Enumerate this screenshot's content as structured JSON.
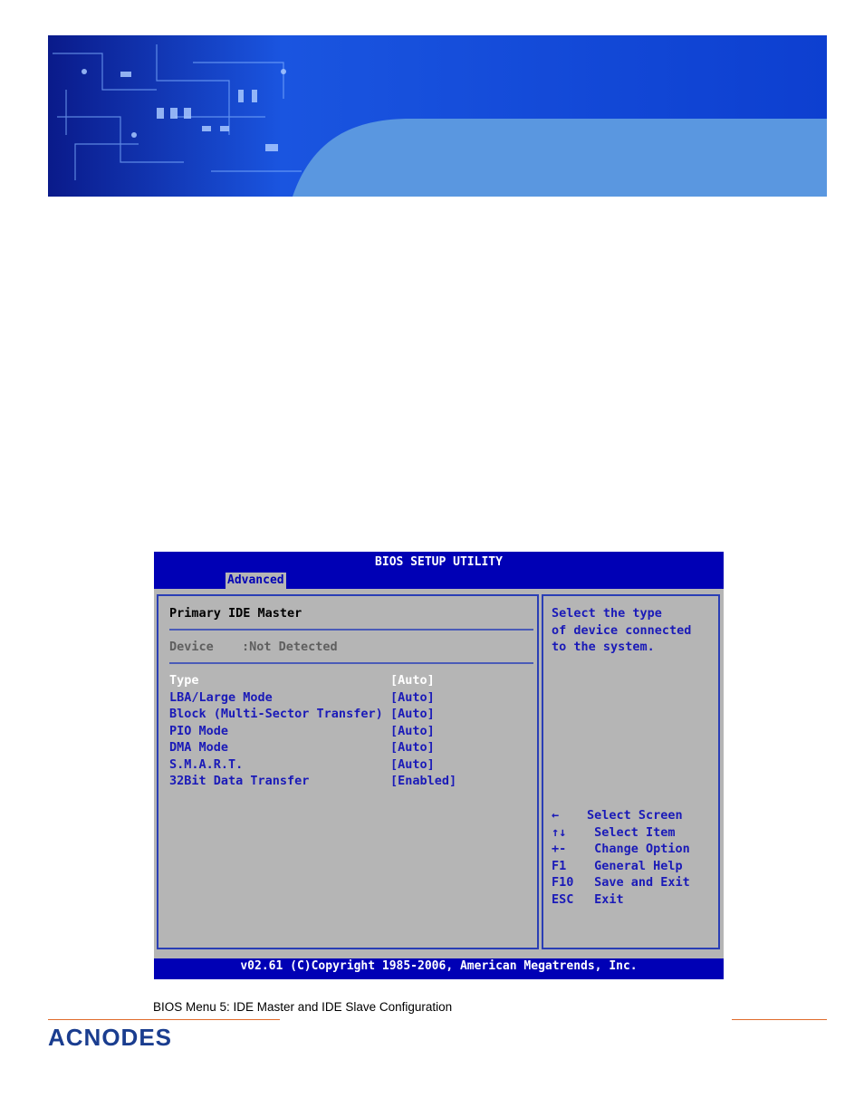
{
  "bios": {
    "title": "BIOS SETUP UTILITY",
    "tab": "Advanced",
    "section_title": "Primary IDE Master",
    "device_label": "Device",
    "device_value": ":Not Detected",
    "options": [
      {
        "label": "Type",
        "value": "[Auto]",
        "selected": true
      },
      {
        "label": "LBA/Large Mode",
        "value": "[Auto]"
      },
      {
        "label": "Block (Multi-Sector Transfer)",
        "value": "[Auto]"
      },
      {
        "label": "PIO Mode",
        "value": "[Auto]"
      },
      {
        "label": "DMA Mode",
        "value": "[Auto]"
      },
      {
        "label": "S.M.A.R.T.",
        "value": "[Auto]"
      },
      {
        "label": "32Bit Data Transfer",
        "value": "[Enabled]"
      }
    ],
    "help": [
      "Select the type",
      "of device connected",
      "to the system."
    ],
    "keys": [
      {
        "key": "←",
        "action": "Select Screen"
      },
      {
        "key": "↑↓",
        "action": " Select Item"
      },
      {
        "key": "+-",
        "action": " Change Option"
      },
      {
        "key": "F1",
        "action": " General Help"
      },
      {
        "key": "F10",
        "action": " Save and Exit"
      },
      {
        "key": "ESC",
        "action": " Exit"
      }
    ],
    "footer": "v02.61 (C)Copyright 1985-2006, American Megatrends, Inc."
  },
  "caption": "BIOS Menu 5: IDE Master and IDE Slave Configuration",
  "logo_text": "ACNODES",
  "colors": {
    "bios_blue": "#0000b5",
    "bios_gray": "#b5b5b5",
    "accent_orange": "#e06b2b"
  }
}
